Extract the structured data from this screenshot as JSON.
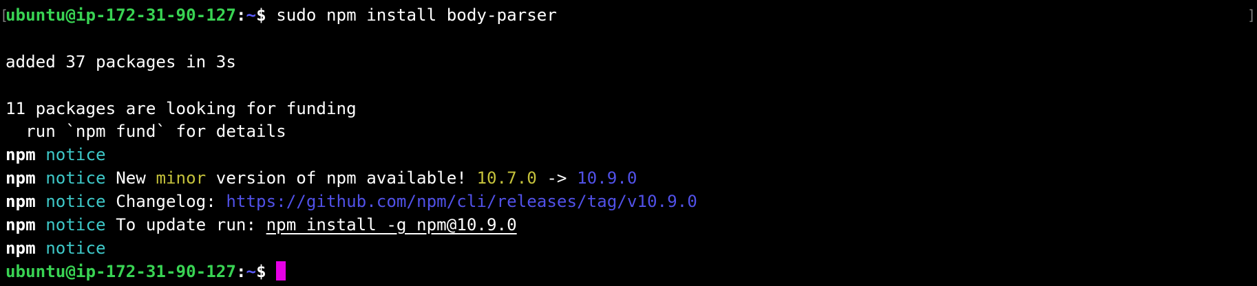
{
  "prompt": {
    "user_host": "ubuntu@ip-172-31-90-127",
    "separator": ":",
    "path": "~",
    "symbol": "$"
  },
  "command": "sudo npm install body-parser",
  "output": {
    "added": "added 37 packages in 3s",
    "funding": "11 packages are looking for funding",
    "fund_hint": "  run `npm fund` for details"
  },
  "notices": {
    "npm_label": "npm",
    "notice_label": "notice",
    "new_prefix": "New ",
    "minor_word": "minor",
    "new_mid": " version of npm available! ",
    "old_version": "10.7.0",
    "arrow": " -> ",
    "new_version": "10.9.0",
    "changelog_label": "Changelog: ",
    "changelog_url": "https://github.com/npm/cli/releases/tag/v10.9.0",
    "update_label": "To update run: ",
    "update_command": "npm install -g npm@10.9.0"
  },
  "colors": {
    "background": "#000000",
    "prompt_user": "#39d353",
    "prompt_path": "#5b5bff",
    "notice": "#3ec9c9",
    "highlight_yellow": "#c5c23b",
    "link_blue": "#5151e8",
    "cursor": "#e600e6"
  }
}
